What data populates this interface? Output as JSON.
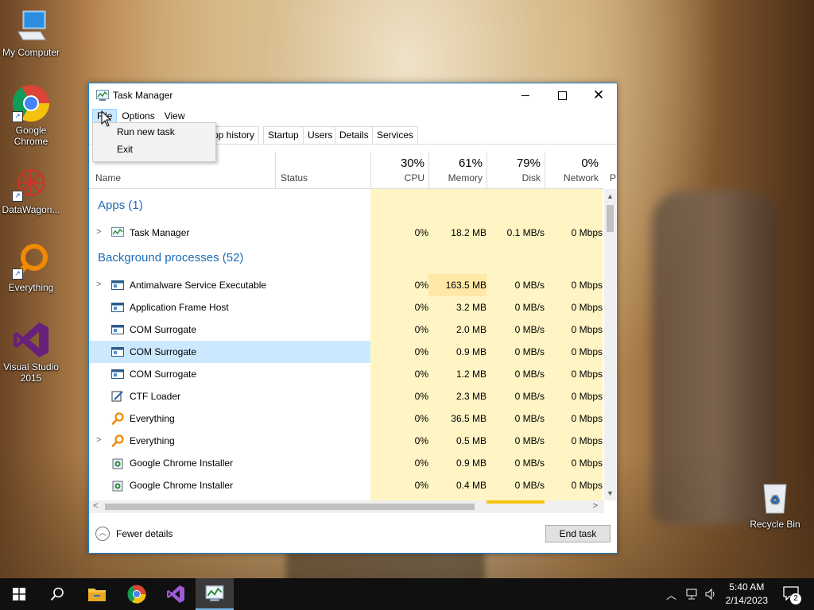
{
  "desktop": {
    "icons": [
      {
        "label": "My Computer"
      },
      {
        "label": "Google Chrome"
      },
      {
        "label": "DataWagon..."
      },
      {
        "label": "Everything"
      },
      {
        "label": "Visual Studio 2015"
      },
      {
        "label": "Recycle Bin"
      }
    ]
  },
  "window": {
    "title": "Task Manager",
    "menu": [
      "File",
      "Options",
      "View"
    ],
    "file_menu_items": [
      "Run new task",
      "Exit"
    ],
    "tabs": [
      "pp history",
      "Startup",
      "Users",
      "Details",
      "Services"
    ],
    "columns": {
      "name": "Name",
      "status": "Status",
      "cpu": {
        "pct": "30%",
        "label": "CPU"
      },
      "memory": {
        "pct": "61%",
        "label": "Memory"
      },
      "disk": {
        "pct": "79%",
        "label": "Disk"
      },
      "network": {
        "pct": "0%",
        "label": "Network"
      },
      "next": "P"
    },
    "groups": {
      "apps": "Apps (1)",
      "background": "Background processes (52)"
    },
    "apps": [
      {
        "name": "Task Manager",
        "cpu": "0%",
        "memory": "18.2 MB",
        "disk": "0.1 MB/s",
        "network": "0 Mbps"
      }
    ],
    "processes": [
      {
        "name": "Antimalware Service Executable",
        "cpu": "0%",
        "memory": "163.5 MB",
        "disk": "0 MB/s",
        "network": "0 Mbps"
      },
      {
        "name": "Application Frame Host",
        "cpu": "0%",
        "memory": "3.2 MB",
        "disk": "0 MB/s",
        "network": "0 Mbps"
      },
      {
        "name": "COM Surrogate",
        "cpu": "0%",
        "memory": "2.0 MB",
        "disk": "0 MB/s",
        "network": "0 Mbps"
      },
      {
        "name": "COM Surrogate",
        "cpu": "0%",
        "memory": "0.9 MB",
        "disk": "0 MB/s",
        "network": "0 Mbps"
      },
      {
        "name": "COM Surrogate",
        "cpu": "0%",
        "memory": "1.2 MB",
        "disk": "0 MB/s",
        "network": "0 Mbps"
      },
      {
        "name": "CTF Loader",
        "cpu": "0%",
        "memory": "2.3 MB",
        "disk": "0 MB/s",
        "network": "0 Mbps"
      },
      {
        "name": "Everything",
        "cpu": "0%",
        "memory": "36.5 MB",
        "disk": "0 MB/s",
        "network": "0 Mbps"
      },
      {
        "name": "Everything",
        "cpu": "0%",
        "memory": "0.5 MB",
        "disk": "0 MB/s",
        "network": "0 Mbps"
      },
      {
        "name": "Google Chrome Installer",
        "cpu": "0%",
        "memory": "0.9 MB",
        "disk": "0 MB/s",
        "network": "0 Mbps"
      },
      {
        "name": "Google Chrome Installer",
        "cpu": "0%",
        "memory": "0.4 MB",
        "disk": "0 MB/s",
        "network": "0 Mbps"
      }
    ],
    "fewer_details": "Fewer details",
    "end_task": "End task"
  },
  "taskbar": {
    "time": "5:40 AM",
    "date": "2/14/2023",
    "notification_count": "2"
  },
  "colors": {
    "accent": "#1883d7",
    "heat_light": "#fff4c4",
    "heat_mid": "#ffe8a6",
    "selection": "#cce8ff",
    "group_text": "#1e6bb8"
  }
}
